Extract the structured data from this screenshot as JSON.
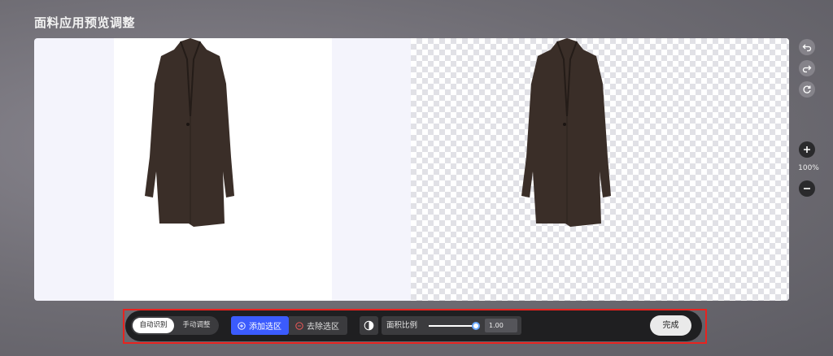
{
  "header": {
    "title": "面料应用预览调整"
  },
  "side_tools": {
    "undo_icon": "undo-icon",
    "redo_icon": "redo-icon",
    "reset_icon": "reset-icon",
    "zoom_in_icon": "plus-icon",
    "zoom_level": "100%",
    "zoom_out_icon": "minus-icon"
  },
  "toolbar": {
    "mode_auto": "自动识别",
    "mode_manual": "手动调整",
    "add_selection": "添加选区",
    "remove_selection": "去除选区",
    "area_ratio_label": "面积比例",
    "area_ratio_value": "1.00",
    "slider_fraction": 1.0,
    "done": "完成"
  },
  "colors": {
    "accent": "#3b5bfd",
    "highlight_border": "#e8231f",
    "coat": "#3a2e28"
  }
}
